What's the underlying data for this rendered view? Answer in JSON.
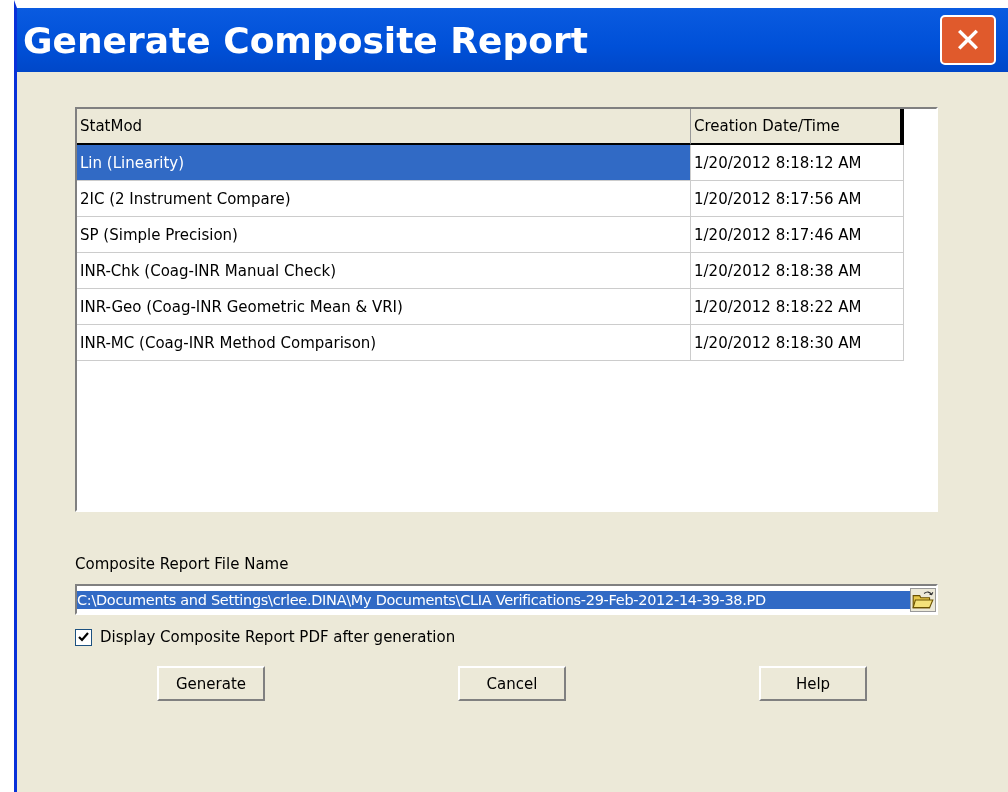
{
  "window": {
    "title": "Generate Composite Report",
    "close_label": "✕"
  },
  "table": {
    "columns": [
      "StatMod",
      "Creation Date/Time"
    ],
    "rows": [
      {
        "cells": [
          "Lin (Linearity)",
          "1/20/2012 8:18:12 AM"
        ],
        "selected": true
      },
      {
        "cells": [
          "2IC (2 Instrument Compare)",
          "1/20/2012 8:17:56 AM"
        ],
        "selected": false
      },
      {
        "cells": [
          "SP (Simple Precision)",
          "1/20/2012 8:17:46 AM"
        ],
        "selected": false
      },
      {
        "cells": [
          "INR-Chk (Coag-INR Manual Check)",
          "1/20/2012 8:18:38 AM"
        ],
        "selected": false
      },
      {
        "cells": [
          "INR-Geo (Coag-INR Geometric Mean & VRI)",
          "1/20/2012 8:18:22 AM"
        ],
        "selected": false
      },
      {
        "cells": [
          "INR-MC (Coag-INR Method Comparison)",
          "1/20/2012 8:18:30 AM"
        ],
        "selected": false
      }
    ]
  },
  "file_name": {
    "label": "Composite Report File Name",
    "value": "C:\\Documents and Settings\\crlee.DINA\\My Documents\\CLIA Verifications-29-Feb-2012-14-39-38.PD",
    "selected": true
  },
  "display_pdf": {
    "label": "Display Composite Report PDF after generation",
    "checked": true
  },
  "buttons": [
    "Generate",
    "Cancel",
    "Help"
  ]
}
